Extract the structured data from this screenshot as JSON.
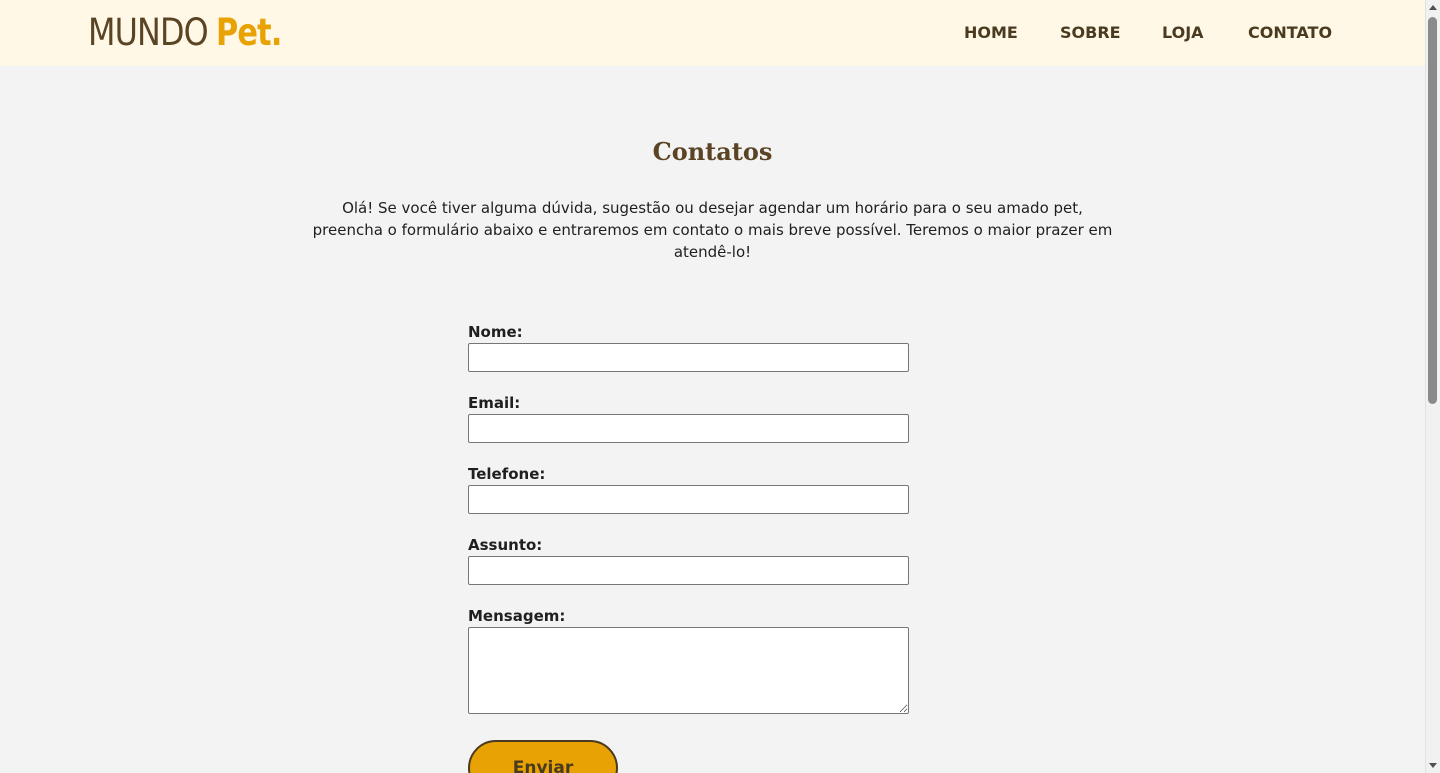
{
  "header": {
    "logo_part1": "MUNDO",
    "logo_part2": "Pet.",
    "nav": [
      "HOME",
      "SOBRE",
      "LOJA",
      "CONTATO"
    ]
  },
  "main": {
    "title": "Contatos",
    "intro": "Olá! Se você tiver alguma dúvida, sugestão ou desejar agendar um horário para o seu amado pet, preencha o formulário abaixo e entraremos em contato o mais breve possível. Teremos o maior prazer em atendê-lo!"
  },
  "form": {
    "fields": [
      {
        "label": "Nome:",
        "value": ""
      },
      {
        "label": "Email:",
        "value": ""
      },
      {
        "label": "Telefone:",
        "value": ""
      },
      {
        "label": "Assunto:",
        "value": ""
      },
      {
        "label": "Mensagem:",
        "value": ""
      }
    ],
    "submit_label": "Enviar"
  },
  "colors": {
    "header_bg": "#fff8e6",
    "page_bg": "#f3f3f3",
    "brown": "#5a4424",
    "accent": "#e9a203"
  }
}
